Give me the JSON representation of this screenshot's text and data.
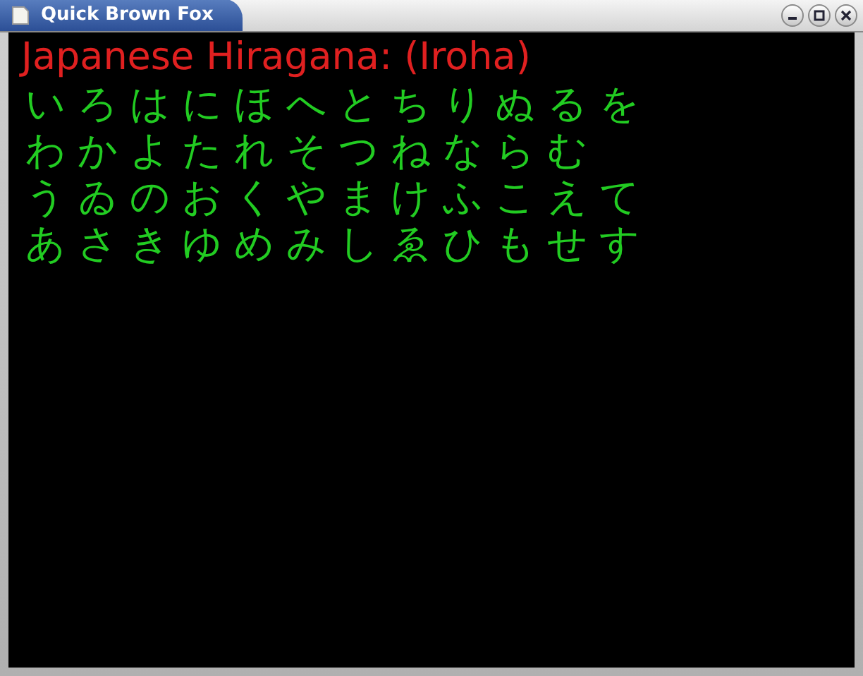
{
  "window": {
    "title": "Quick Brown Fox"
  },
  "heading": "Japanese Hiragana: (Iroha)",
  "lines": [
    "いろはにほへとちりぬるを",
    "わかよたれそつねならむ",
    "うゐのおくやまけふこえて",
    "あさきゆめみしゑひもせす"
  ]
}
